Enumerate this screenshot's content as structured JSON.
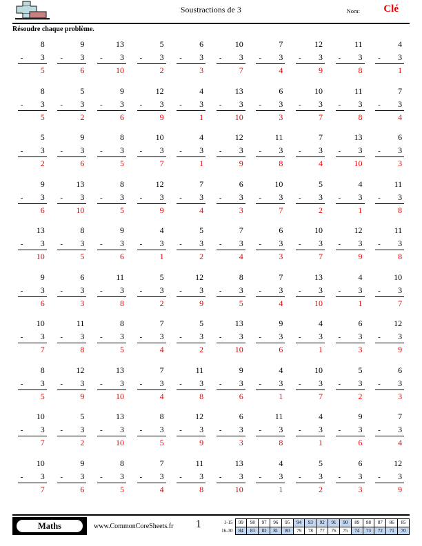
{
  "header": {
    "title": "Soustractions de 3",
    "name_label": "Nom:",
    "name_value": "Clé",
    "instructions": "Résoudre chaque problème.",
    "logo_icon": "plus-minus-logo"
  },
  "problems": {
    "operator": "-",
    "subtrahend": "3",
    "rows": [
      {
        "minuends": [
          8,
          9,
          13,
          5,
          6,
          10,
          7,
          12,
          11,
          4
        ],
        "answers": [
          5,
          6,
          10,
          2,
          3,
          7,
          4,
          9,
          8,
          1
        ]
      },
      {
        "minuends": [
          8,
          5,
          9,
          12,
          4,
          13,
          6,
          10,
          11,
          7
        ],
        "answers": [
          5,
          2,
          6,
          9,
          1,
          10,
          3,
          7,
          8,
          4
        ]
      },
      {
        "minuends": [
          5,
          9,
          8,
          10,
          4,
          12,
          11,
          7,
          13,
          6
        ],
        "answers": [
          2,
          6,
          5,
          7,
          1,
          9,
          8,
          4,
          10,
          3
        ]
      },
      {
        "minuends": [
          9,
          13,
          8,
          12,
          7,
          6,
          10,
          5,
          4,
          11
        ],
        "answers": [
          6,
          10,
          5,
          9,
          4,
          3,
          7,
          2,
          1,
          8
        ]
      },
      {
        "minuends": [
          13,
          8,
          9,
          4,
          5,
          7,
          6,
          10,
          12,
          11
        ],
        "answers": [
          10,
          5,
          6,
          1,
          2,
          4,
          3,
          7,
          9,
          8
        ]
      },
      {
        "minuends": [
          9,
          6,
          11,
          5,
          12,
          8,
          7,
          13,
          4,
          10
        ],
        "answers": [
          6,
          3,
          8,
          2,
          9,
          5,
          4,
          10,
          1,
          7
        ]
      },
      {
        "minuends": [
          10,
          11,
          8,
          7,
          5,
          13,
          9,
          4,
          6,
          12
        ],
        "answers": [
          7,
          8,
          5,
          4,
          2,
          10,
          6,
          1,
          3,
          9
        ]
      },
      {
        "minuends": [
          8,
          12,
          13,
          7,
          11,
          9,
          4,
          10,
          5,
          6
        ],
        "answers": [
          5,
          9,
          10,
          4,
          8,
          6,
          1,
          7,
          2,
          3
        ]
      },
      {
        "minuends": [
          10,
          5,
          13,
          8,
          12,
          6,
          11,
          4,
          9,
          7
        ],
        "answers": [
          7,
          2,
          10,
          5,
          9,
          3,
          8,
          1,
          6,
          4
        ]
      },
      {
        "minuends": [
          10,
          9,
          8,
          7,
          11,
          13,
          4,
          5,
          6,
          12
        ],
        "answers": [
          7,
          6,
          5,
          4,
          8,
          10,
          1,
          2,
          3,
          9
        ]
      }
    ]
  },
  "footer": {
    "brand": "Maths",
    "site": "www.CommonCoreSheets.fr",
    "page_number": "1",
    "score_table": {
      "row_labels": [
        "1-15",
        "16-30"
      ],
      "rows": [
        {
          "values": [
            99,
            98,
            97,
            96,
            95,
            94,
            93,
            92,
            91,
            90,
            89,
            88,
            87,
            86,
            85
          ],
          "shaded": [
            false,
            false,
            false,
            false,
            false,
            true,
            true,
            true,
            true,
            true,
            false,
            false,
            false,
            false,
            false
          ]
        },
        {
          "values": [
            84,
            83,
            82,
            81,
            80,
            79,
            78,
            77,
            76,
            75,
            74,
            73,
            72,
            71,
            70
          ],
          "shaded": [
            true,
            true,
            true,
            true,
            true,
            false,
            false,
            false,
            false,
            false,
            true,
            true,
            true,
            true,
            true
          ]
        }
      ]
    }
  },
  "colors": {
    "answer_red": "#ee0000",
    "shade_blue": "#c3d6ef",
    "logo_blue": "#bcdce0",
    "logo_red": "#c98080"
  }
}
